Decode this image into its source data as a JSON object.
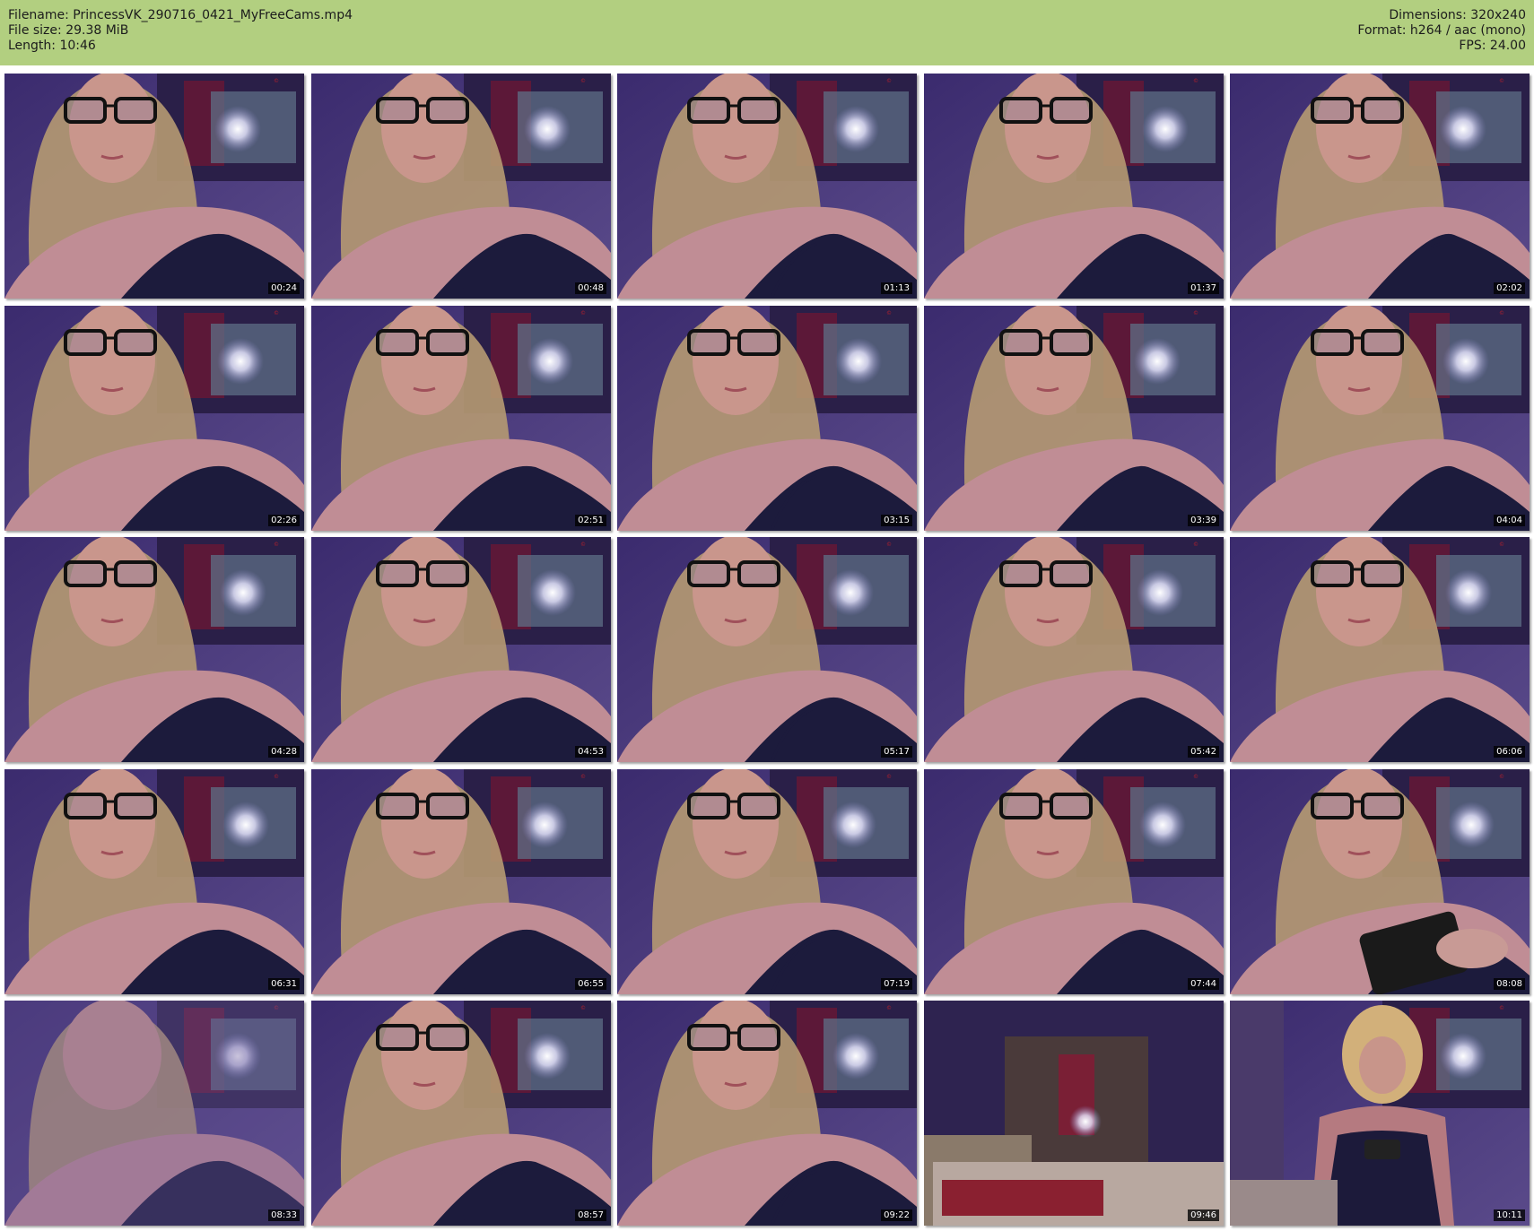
{
  "info": {
    "filename": "Filename: PrincessVK_290716_0421_MyFreeCams.mp4",
    "file_size": "File size: 29.38 MiB",
    "length": "Length: 10:46",
    "dimensions": "Dimensions: 320x240",
    "format": "Format: h264 / aac (mono)",
    "fps": "FPS: 24.00"
  },
  "colors": {
    "header_bg": "#b2cf80",
    "timestamp_bg": "#000000",
    "timestamp_text": "#ffffff"
  },
  "thumbnails": [
    {
      "time": "00:24",
      "scene": "closeup"
    },
    {
      "time": "00:48",
      "scene": "closeup"
    },
    {
      "time": "01:13",
      "scene": "closeup"
    },
    {
      "time": "01:37",
      "scene": "closeup"
    },
    {
      "time": "02:02",
      "scene": "closeup"
    },
    {
      "time": "02:26",
      "scene": "closeup"
    },
    {
      "time": "02:51",
      "scene": "closeup"
    },
    {
      "time": "03:15",
      "scene": "closeup"
    },
    {
      "time": "03:39",
      "scene": "closeup"
    },
    {
      "time": "04:04",
      "scene": "closeup"
    },
    {
      "time": "04:28",
      "scene": "closeup"
    },
    {
      "time": "04:53",
      "scene": "closeup"
    },
    {
      "time": "05:17",
      "scene": "closeup"
    },
    {
      "time": "05:42",
      "scene": "closeup"
    },
    {
      "time": "06:06",
      "scene": "closeup"
    },
    {
      "time": "06:31",
      "scene": "closeup"
    },
    {
      "time": "06:55",
      "scene": "closeup"
    },
    {
      "time": "07:19",
      "scene": "closeup"
    },
    {
      "time": "07:44",
      "scene": "closeup"
    },
    {
      "time": "08:08",
      "scene": "phone"
    },
    {
      "time": "08:33",
      "scene": "blur"
    },
    {
      "time": "08:57",
      "scene": "closeup"
    },
    {
      "time": "09:22",
      "scene": "closeup"
    },
    {
      "time": "09:46",
      "scene": "room"
    },
    {
      "time": "10:11",
      "scene": "wide"
    }
  ]
}
